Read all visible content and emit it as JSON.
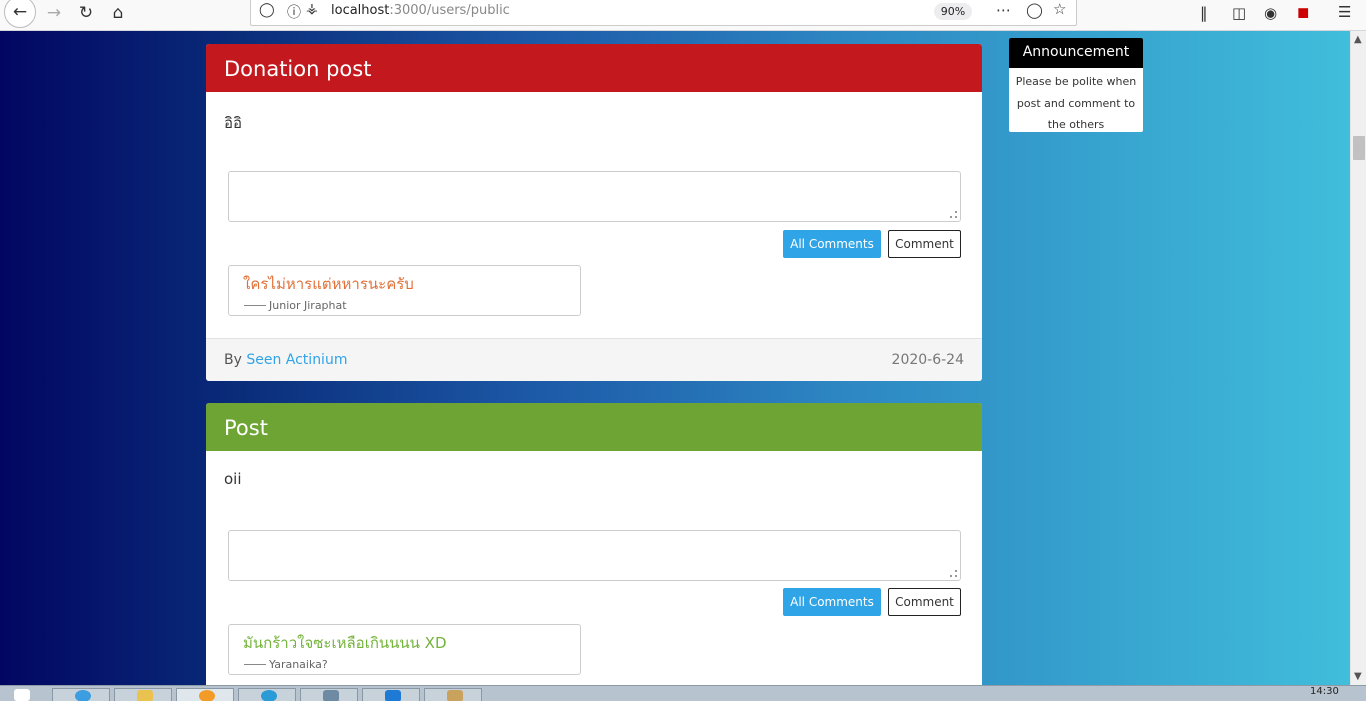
{
  "browser": {
    "url_host": "localhost",
    "url_path": ":3000/users/public",
    "zoom": "90%"
  },
  "posts": [
    {
      "type_label": "Donation post",
      "header_color": "#c3191e",
      "text": "อิอิ",
      "all_comments_label": "All Comments",
      "comment_label": "Comment",
      "comment": {
        "text": "ใครไม่หารแต่หหารนะครับ",
        "text_color": "#e07038",
        "author": "Junior Jiraphat"
      },
      "footer": {
        "by_label": "By",
        "author": "Seen Actinium",
        "date": "2020-6-24"
      }
    },
    {
      "type_label": "Post",
      "header_color": "#6ea434",
      "text": "oii",
      "all_comments_label": "All Comments",
      "comment_label": "Comment",
      "comment": {
        "text": "มันกร้าวใจซะเหลือเกินนนน XD",
        "text_color": "#73b33a",
        "author": "Yaranaika?"
      }
    }
  ],
  "announcement": {
    "title": "Announcement",
    "text": "Please be polite when post and comment to the others"
  },
  "taskbar": {
    "clock": "14:30"
  },
  "icons": {
    "back": "arrow-left-icon",
    "forward": "arrow-right-icon",
    "reload": "reload-icon",
    "home": "home-icon"
  }
}
